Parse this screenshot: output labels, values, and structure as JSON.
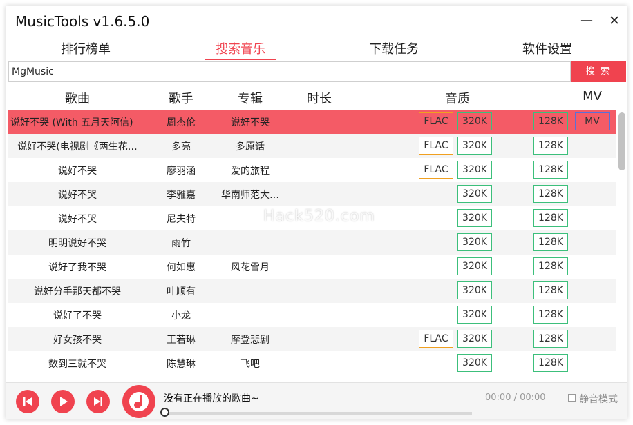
{
  "app": {
    "title": "MusicTools v1.6.5.0"
  },
  "window_controls": {
    "minimize": "—",
    "close": "✕"
  },
  "tabs": [
    {
      "label": "排行榜单"
    },
    {
      "label": "搜索音乐"
    },
    {
      "label": "下载任务"
    },
    {
      "label": "软件设置"
    }
  ],
  "search": {
    "source_value": "MgMusic",
    "keyword_value": "",
    "button_label": "搜 索"
  },
  "table": {
    "columns": {
      "song": "歌曲",
      "artist": "歌手",
      "album": "专辑",
      "duration": "时长",
      "quality": "音质",
      "mv": "MV"
    },
    "rows": [
      {
        "song": "说好不哭 (With 五月天阿信)",
        "artist": "周杰伦",
        "album": "说好不哭",
        "flac": "FLAC",
        "q320": "320K",
        "q128": "128K",
        "mv": "MV"
      },
      {
        "song": "说好不哭(电视剧《两生花…",
        "artist": "多亮",
        "album": "多原话",
        "flac": "FLAC",
        "q320": "320K",
        "q128": "128K"
      },
      {
        "song": "说好不哭",
        "artist": "廖羽涵",
        "album": "爱的旅程",
        "flac": "FLAC",
        "q320": "320K",
        "q128": "128K"
      },
      {
        "song": "说好不哭",
        "artist": "李雅嘉",
        "album": "华南师范大…",
        "q320": "320K",
        "q128": "128K"
      },
      {
        "song": "说好不哭",
        "artist": "尼夫特",
        "album": "",
        "q320": "320K",
        "q128": "128K"
      },
      {
        "song": "明明说好不哭",
        "artist": "雨竹",
        "album": "",
        "q320": "320K",
        "q128": "128K"
      },
      {
        "song": "说好了我不哭",
        "artist": "何如惠",
        "album": "风花雪月",
        "q320": "320K",
        "q128": "128K"
      },
      {
        "song": "说好分手那天都不哭",
        "artist": "叶顺有",
        "album": "",
        "q320": "320K",
        "q128": "128K"
      },
      {
        "song": "说好了不哭",
        "artist": "小龙",
        "album": "",
        "q320": "320K",
        "q128": "128K"
      },
      {
        "song": "好女孩不哭",
        "artist": "王若琳",
        "album": "摩登悲剧",
        "flac": "FLAC",
        "q320": "320K",
        "q128": "128K"
      },
      {
        "song": "数到三就不哭",
        "artist": "陈慧琳",
        "album": "飞吧",
        "q320": "320K",
        "q128": "128K"
      }
    ]
  },
  "player": {
    "now_playing": "没有正在播放的歌曲~",
    "time": "00:00 / 00:00",
    "mute_label": "静音模式",
    "progress": 0
  },
  "watermark": {
    "text": "Hack520.com"
  },
  "colors": {
    "accent": "#f0434f",
    "selected_row": "#f45b66",
    "flac_border": "#f0a020",
    "quality_border": "#3cbf7b",
    "mv_border": "#5a6fd8"
  },
  "icons": {
    "prev": "skip-previous-icon",
    "play": "play-icon",
    "next": "skip-next-icon",
    "logo": "music-note-icon"
  }
}
